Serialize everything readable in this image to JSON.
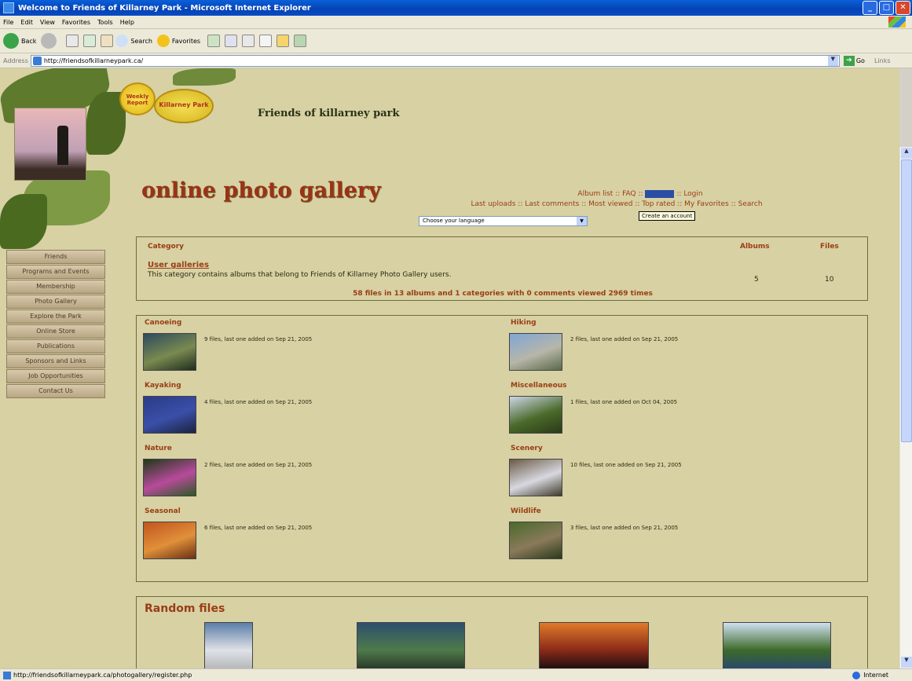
{
  "window": {
    "title": "Welcome to Friends of Killarney Park - Microsoft Internet Explorer"
  },
  "menu": [
    "File",
    "Edit",
    "View",
    "Favorites",
    "Tools",
    "Help"
  ],
  "toolbar": {
    "back": "Back",
    "search": "Search",
    "favorites": "Favorites"
  },
  "address": {
    "label": "Address",
    "url": "http://friendsofkillarneypark.ca/",
    "go": "Go",
    "links": "Links"
  },
  "page": {
    "site_title": "Friends of killarney park",
    "gallery_title": "online photo gallery",
    "badge1": "Weekly Report",
    "badge2": "Killarney Park",
    "nav_row1": [
      {
        "label": "Album list"
      },
      {
        "label": "FAQ"
      },
      {
        "label": "Register",
        "highlighted": true
      },
      {
        "label": "Login"
      }
    ],
    "nav_row2": [
      {
        "label": "Last uploads"
      },
      {
        "label": "Last comments"
      },
      {
        "label": "Most viewed"
      },
      {
        "label": "Top rated"
      },
      {
        "label": "My Favorites"
      },
      {
        "label": "Search"
      }
    ],
    "tooltip": "Create an account",
    "language_select": "Choose your language",
    "side_nav": [
      "Friends",
      "Programs and Events",
      "Membership",
      "Photo Gallery",
      "Explore the Park",
      "Online Store",
      "Publications",
      "Sponsors and Links",
      "Job Opportunities",
      "Contact Us"
    ],
    "category_table": {
      "headers": {
        "category": "Category",
        "albums": "Albums",
        "files": "Files"
      },
      "row": {
        "name": "User galleries",
        "description": "This category contains albums that belong to Friends of Killarney Photo Gallery users.",
        "albums": "5",
        "files": "10"
      },
      "stats": "58 files in 13 albums and 1 categories with 0 comments viewed 2969 times"
    },
    "albums": [
      {
        "name": "Canoeing",
        "info": "9 files, last one added on Sep 21, 2005",
        "colors": [
          "#2d4a5e",
          "#7a8a50",
          "#1f2d1e"
        ]
      },
      {
        "name": "Hiking",
        "info": "2 files, last one added on Sep 21, 2005",
        "colors": [
          "#7fa6d6",
          "#b7b6a8",
          "#5a6a4a"
        ]
      },
      {
        "name": "Kayaking",
        "info": "4 files, last one added on Sep 21, 2005",
        "colors": [
          "#2a3c86",
          "#3a4fa8",
          "#1b2240"
        ]
      },
      {
        "name": "Miscellaneous",
        "info": "1 files, last one added on Oct 04, 2005",
        "colors": [
          "#cdd6e6",
          "#4b6a2a",
          "#2b3a18"
        ]
      },
      {
        "name": "Nature",
        "info": "2 files, last one added on Sep 21, 2005",
        "colors": [
          "#1e3a18",
          "#b84a9c",
          "#2c5a22"
        ]
      },
      {
        "name": "Scenery",
        "info": "10 files, last one added on Sep 21, 2005",
        "colors": [
          "#6a5a46",
          "#d8d8e0",
          "#3e3a2a"
        ]
      },
      {
        "name": "Seasonal",
        "info": "6 files, last one added on Sep 21, 2005",
        "colors": [
          "#c2541e",
          "#e0903a",
          "#6a3014"
        ]
      },
      {
        "name": "Wildlife",
        "info": "3 files, last one added on Sep 21, 2005",
        "colors": [
          "#4a6a2a",
          "#8a7a5a",
          "#2a3a1a"
        ]
      }
    ],
    "random": {
      "title": "Random files",
      "thumbs": [
        {
          "colors": [
            "#5b7ea8",
            "#dfe2e6",
            "#b6b8bb"
          ]
        },
        {
          "colors": [
            "#2e4e6e",
            "#4e7a4a",
            "#2a3a2a"
          ]
        },
        {
          "colors": [
            "#e07a2a",
            "#8a2a18",
            "#201010"
          ]
        },
        {
          "colors": [
            "#cfe0f0",
            "#3d6a2a",
            "#2a4a6a"
          ]
        }
      ]
    }
  },
  "status": {
    "url": "http://friendsofkillarneypark.ca/photogallery/register.php",
    "zone": "Internet"
  }
}
